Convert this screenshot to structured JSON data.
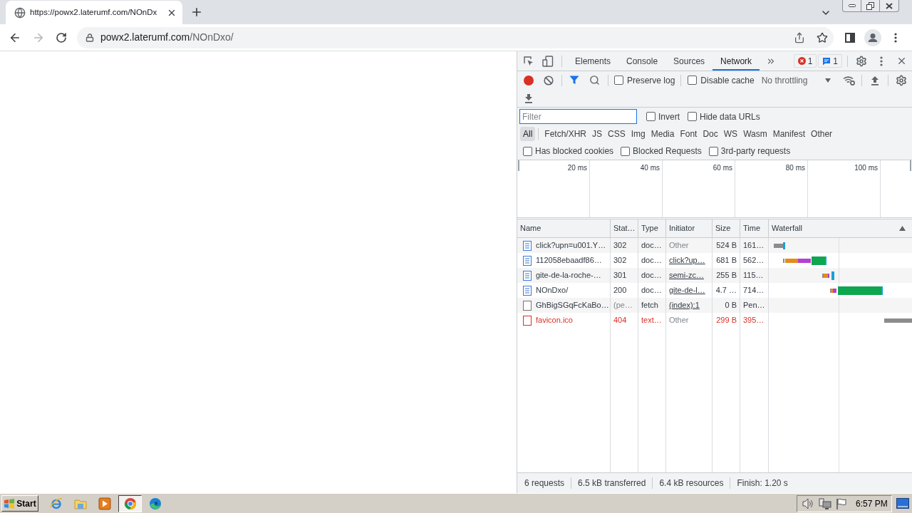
{
  "browser": {
    "tabs": [
      {
        "title": "https://powx2.laterumf.com/NOnDx",
        "selected": true
      }
    ],
    "forward_disabled": true,
    "address": {
      "host": "powx2.laterumf.com",
      "path": "/NOnDxo/"
    }
  },
  "devtools": {
    "panels": [
      {
        "label": "Elements",
        "selected": false
      },
      {
        "label": "Console",
        "selected": false
      },
      {
        "label": "Sources",
        "selected": false
      },
      {
        "label": "Network",
        "selected": true
      }
    ],
    "error_count": "1",
    "message_count": "1",
    "toolbar": {
      "recording": true,
      "options": [
        {
          "label": "Preserve log",
          "checked": false
        },
        {
          "label": "Disable cache",
          "checked": false
        }
      ],
      "throttling": "No throttling"
    },
    "filter": {
      "placeholder": "Filter",
      "options": [
        {
          "label": "Invert",
          "checked": false
        },
        {
          "label": "Hide data URLs",
          "checked": false
        }
      ]
    },
    "resource_types": [
      {
        "label": "All",
        "selected": true
      },
      {
        "label": "Fetch/XHR",
        "selected": false
      },
      {
        "label": "JS",
        "selected": false
      },
      {
        "label": "CSS",
        "selected": false
      },
      {
        "label": "Img",
        "selected": false
      },
      {
        "label": "Media",
        "selected": false
      },
      {
        "label": "Font",
        "selected": false
      },
      {
        "label": "Doc",
        "selected": false
      },
      {
        "label": "WS",
        "selected": false
      },
      {
        "label": "Wasm",
        "selected": false
      },
      {
        "label": "Manifest",
        "selected": false
      },
      {
        "label": "Other",
        "selected": false
      }
    ],
    "request_filters": [
      {
        "label": "Has blocked cookies",
        "checked": false
      },
      {
        "label": "Blocked Requests",
        "checked": false
      },
      {
        "label": "3rd-party requests",
        "checked": false
      }
    ],
    "overview": {
      "ticks": [
        "20 ms",
        "40 ms",
        "60 ms",
        "80 ms",
        "100 ms"
      ]
    },
    "table": {
      "columns": [
        "Name",
        "Stat…",
        "Type",
        "Initiator",
        "Size",
        "Time",
        "Waterfall"
      ],
      "rows": [
        {
          "kind": "document",
          "failed": false,
          "pending": false,
          "name": "click?upn=u001.Y…",
          "status": "302",
          "type": "doc…",
          "initiator": {
            "text": "Other",
            "link": false
          },
          "size": "524 B",
          "time": "161…"
        },
        {
          "kind": "document",
          "failed": false,
          "pending": false,
          "name": "112058ebaadf86…",
          "status": "302",
          "type": "doc…",
          "initiator": {
            "text": "click?up…",
            "link": true
          },
          "size": "681 B",
          "time": "562…"
        },
        {
          "kind": "document",
          "failed": false,
          "pending": false,
          "name": "gite-de-la-roche-…",
          "status": "301",
          "type": "doc…",
          "initiator": {
            "text": "semi-zc…",
            "link": true
          },
          "size": "255 B",
          "time": "115…"
        },
        {
          "kind": "document",
          "failed": false,
          "pending": false,
          "name": "NOnDxo/",
          "status": "200",
          "type": "doc…",
          "initiator": {
            "text": "gite-de-l…",
            "link": true
          },
          "size": "4.7 …",
          "time": "714…"
        },
        {
          "kind": "other",
          "failed": false,
          "pending": true,
          "name": "GhBigSGqFcKaBo…",
          "status": "(pe…",
          "type": "fetch",
          "initiator": {
            "text": "(index):1",
            "link": true
          },
          "size": "0 B",
          "time": "Pen…"
        },
        {
          "kind": "other",
          "failed": true,
          "pending": false,
          "name": "favicon.ico",
          "status": "404",
          "type": "text…",
          "initiator": {
            "text": "Other",
            "link": false
          },
          "size": "299 B",
          "time": "395…"
        }
      ]
    },
    "status_bar": [
      "6 requests",
      "6.5 kB transferred",
      "6.4 kB resources",
      "Finish: 1.20 s"
    ]
  },
  "taskbar": {
    "start": "Start",
    "apps": [
      {
        "kind": "ie",
        "selected": false
      },
      {
        "kind": "folder",
        "selected": false
      },
      {
        "kind": "player",
        "selected": false
      },
      {
        "kind": "chrome",
        "selected": true
      },
      {
        "kind": "edge",
        "selected": false
      }
    ],
    "clock": "6:57 PM"
  }
}
